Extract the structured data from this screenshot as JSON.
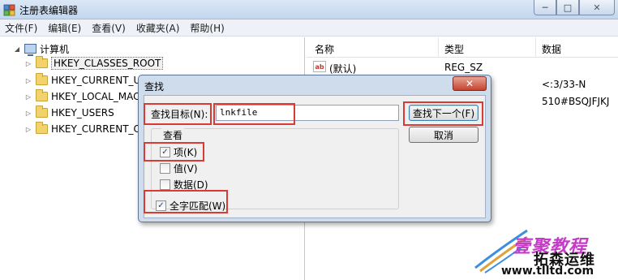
{
  "window": {
    "title": "注册表编辑器",
    "controls": {
      "minimize": "─",
      "maximize": "□",
      "close": "✕"
    }
  },
  "menu": [
    "文件(F)",
    "编辑(E)",
    "查看(V)",
    "收藏夹(A)",
    "帮助(H)"
  ],
  "tree": {
    "root": "计算机",
    "items": [
      "HKEY_CLASSES_ROOT",
      "HKEY_CURRENT_U",
      "HKEY_LOCAL_MAC",
      "HKEY_USERS",
      "HKEY_CURRENT_C"
    ]
  },
  "list": {
    "columns": [
      "名称",
      "类型",
      "数据"
    ],
    "rows": [
      {
        "name": "(默认)",
        "type": "REG_SZ",
        "data": ""
      },
      {
        "name": "",
        "type": "",
        "data": "<:3/33-N"
      },
      {
        "name": "",
        "type": "",
        "data": "510#BSQJFJKJ"
      }
    ]
  },
  "find_dialog": {
    "title": "查找",
    "close": "✕",
    "target_label": "查找目标(N):",
    "target_value": "lnkfile",
    "find_next": "查找下一个(F)",
    "cancel": "取消",
    "look_at_title": "查看",
    "options": [
      {
        "label": "项(K)",
        "checked": true
      },
      {
        "label": "值(V)",
        "checked": false
      },
      {
        "label": "数据(D)",
        "checked": false
      }
    ],
    "match_whole": {
      "label": "全字匹配(W)",
      "checked": true
    }
  },
  "watermark": {
    "line1": "壹聚教程",
    "line2": "拓森运维",
    "line3": "www.tlltd.com"
  },
  "colors": {
    "highlight_box": "#d93a33",
    "dialog_frame": "#cfdcec",
    "watermark_accent": "#c33cc6"
  }
}
